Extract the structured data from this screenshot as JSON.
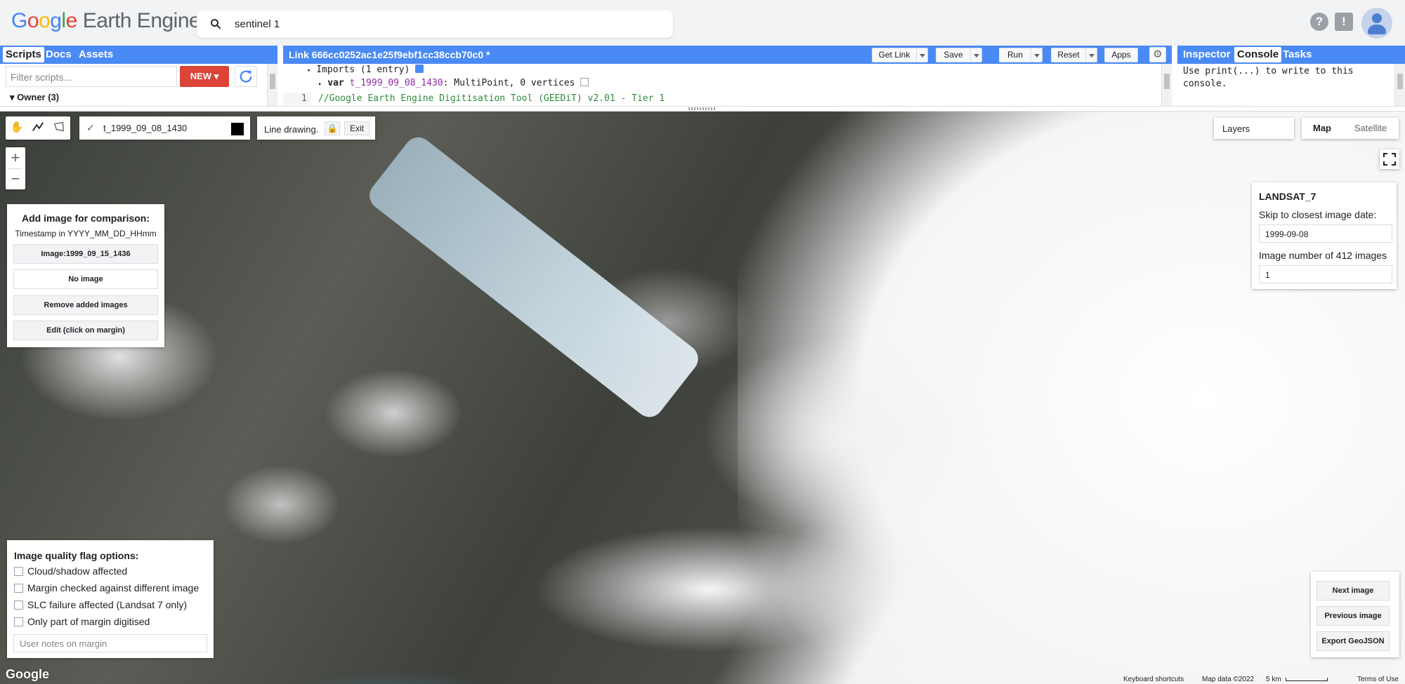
{
  "header": {
    "logo_google": "Google",
    "logo_product": "Earth Engine",
    "search_value": "sentinel 1",
    "help_icon": "?",
    "feedback_icon": "!"
  },
  "left_panel": {
    "tabs": [
      "Scripts",
      "Docs",
      "Assets"
    ],
    "filter_placeholder": "Filter scripts...",
    "new_button": "NEW",
    "owner_label": "Owner (3)"
  },
  "editor": {
    "title": "Link 666cc0252ac1e25f9ebf1cc38ccb70c0 *",
    "buttons": [
      "Get Link",
      "Save",
      "Run",
      "Reset",
      "Apps"
    ],
    "imports_line": "Imports (1 entry)",
    "var_keyword": "var",
    "var_name": "t_1999_09_08_1430",
    "var_desc": ": MultiPoint, 0 vertices",
    "line_number": "1",
    "comment_line": "//Google Earth Engine Digitisation Tool (GEEDiT) v2.01 - Tier 1"
  },
  "right_panel": {
    "tabs": [
      "Inspector",
      "Console",
      "Tasks"
    ],
    "console_text": "Use print(...) to write to this console."
  },
  "map": {
    "layer_name": "t_1999_09_08_1430",
    "line_drawing_label": "Line drawing.",
    "exit_label": "Exit",
    "zoom_in": "+",
    "zoom_out": "−",
    "layers_label": "Layers",
    "map_label": "Map",
    "satellite_label": "Satellite",
    "compare": {
      "title": "Add image for comparison:",
      "subtitle": "Timestamp in YYYY_MM_DD_HHmm",
      "image_button": "Image:1999_09_15_1436",
      "no_image": "No image",
      "remove_button": "Remove added images",
      "edit_button": "Edit (click on margin)"
    },
    "landsat": {
      "title": "LANDSAT_7",
      "skip_label": "Skip to closest image date:",
      "date_value": "1999-09-08",
      "count_label": "Image number of 412 images",
      "number_value": "1"
    },
    "quality": {
      "title": "Image quality flag options:",
      "options": [
        "Cloud/shadow affected",
        "Margin checked against different image",
        "SLC failure affected (Landsat 7 only)",
        "Only part of margin digitised"
      ],
      "notes_placeholder": "User notes on margin"
    },
    "nav": {
      "next": "Next image",
      "previous": "Previous image",
      "export": "Export GeoJSON"
    },
    "footer": {
      "google": "Google",
      "keyboard": "Keyboard shortcuts",
      "map_data": "Map data ©2022",
      "scale": "5 km",
      "terms": "Terms of Use"
    }
  }
}
